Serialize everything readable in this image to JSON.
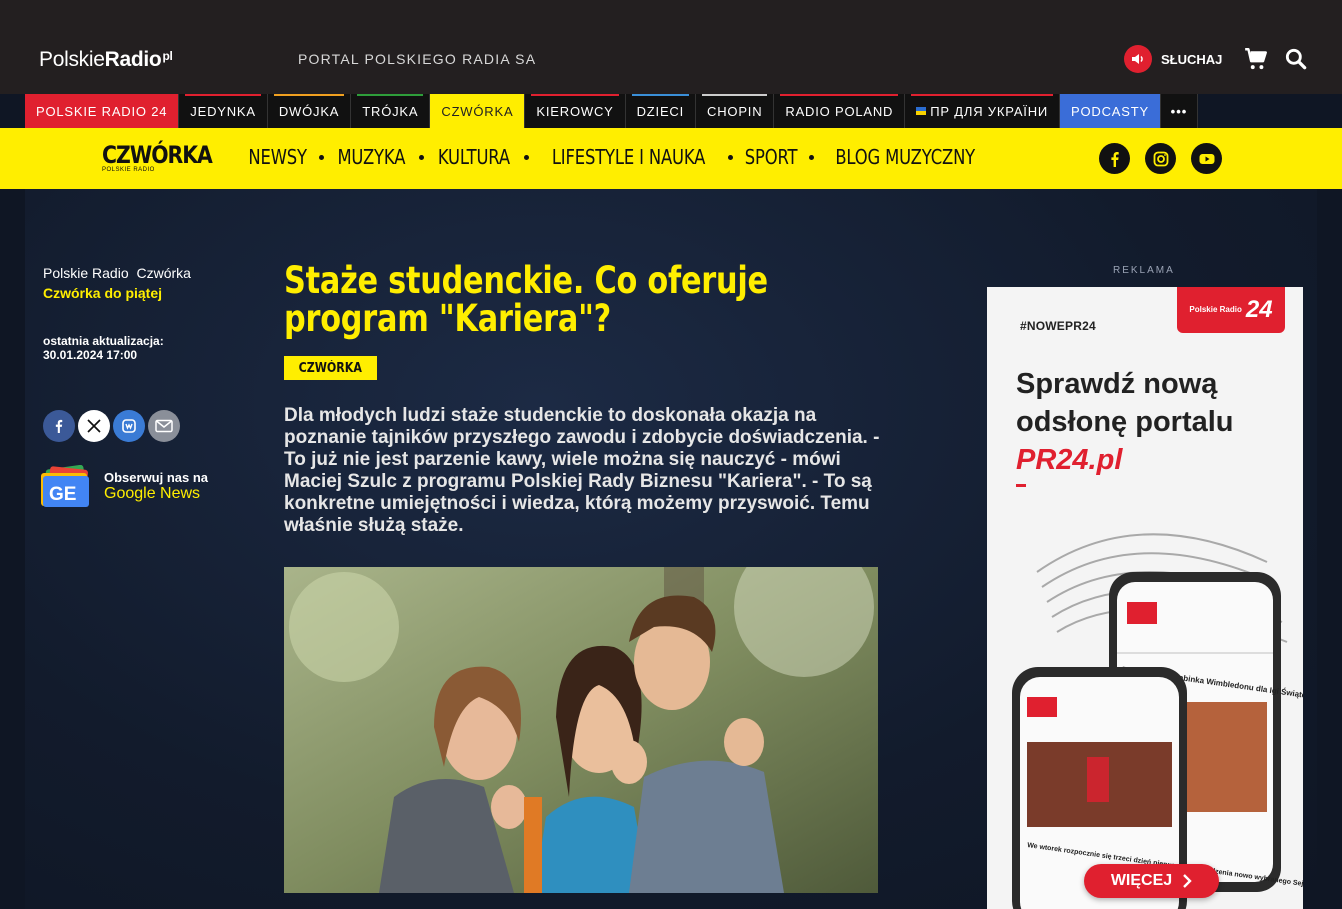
{
  "header": {
    "logo_main": "Polskie",
    "logo_bold": "Radio",
    "logo_sup": "pl",
    "portal_text": "PORTAL POLSKIEGO RADIA SA",
    "listen_label": "SŁUCHAJ"
  },
  "stations": [
    {
      "label": "POLSKIE RADIO 24",
      "accent": "#e0202f"
    },
    {
      "label": "JEDYNKA",
      "accent": "#e0202f"
    },
    {
      "label": "DWÓJKA",
      "accent": "#f0a020"
    },
    {
      "label": "TRÓJKA",
      "accent": "#2e9d3a"
    },
    {
      "label": "CZWÓRKA",
      "accent": "#ffee00"
    },
    {
      "label": "KIEROWCY",
      "accent": "#e0202f"
    },
    {
      "label": "DZIECI",
      "accent": "#3a8fd8"
    },
    {
      "label": "CHOPIN",
      "accent": "#cccccc"
    },
    {
      "label": "RADIO POLAND",
      "accent": "#e0202f"
    },
    {
      "label": "ПР ДЛЯ УКРАЇНИ",
      "accent": "#e0202f"
    },
    {
      "label": "PODCASTY",
      "accent": "#3a6dd8"
    }
  ],
  "stations_more": "•••",
  "channel": {
    "logo": "CZWÓRKA",
    "logo_sub": "POLSKIE RADIO",
    "nav": [
      "NEWSY",
      "MUZYKA",
      "KULTURA",
      "LIFESTYLE I NAUKA",
      "SPORT",
      "BLOG MUZYCZNY"
    ]
  },
  "breadcrumb": {
    "items": [
      "Polskie Radio",
      "Czwórka"
    ],
    "program": "Czwórka do piątej"
  },
  "update": {
    "label": "ostatnia aktualizacja:",
    "date": "30.01.2024 17:00"
  },
  "gnews": {
    "line1": "Obserwuj nas na",
    "line2": "Google News"
  },
  "article": {
    "title": "Staże studenckie. Co oferuje program \"Kariera\"?",
    "tag": "CZWÓRKA",
    "lead": "Dla młodych ludzi staże studenckie to doskonała okazja na poznanie tajników przyszłego zawodu i zdobycie doświadczenia. - To już nie jest parzenie kawy, wiele można się nauczyć - mówi Maciej Szulc z programu Polskiej Rady Biznesu \"Kariera\". - To są konkretne umiejętności i wiedza, którą możemy przyswoić. Temu właśnie służą staże."
  },
  "ad": {
    "label": "REKLAMA",
    "hashtag": "#NOWEPR24",
    "logo_small": "Polskie Radio",
    "logo_big": "24",
    "headline1": "Sprawdź nową",
    "headline2": "odsłonę portalu",
    "headline3": "PR24.pl",
    "phone_text1": "Tak wygląda drabinka Wimbledonu dla Igi Świątek",
    "phone_text2": "We wtorek rozpocznie się trzeci dzień pierwszego posiedzenia nowo wybranego Sejmu",
    "button": "WIĘCEJ"
  },
  "colors": {
    "brand_yellow": "#ffee00",
    "brand_red": "#e0202f",
    "header_bg": "#231f20",
    "page_bg": "#0f1624"
  }
}
